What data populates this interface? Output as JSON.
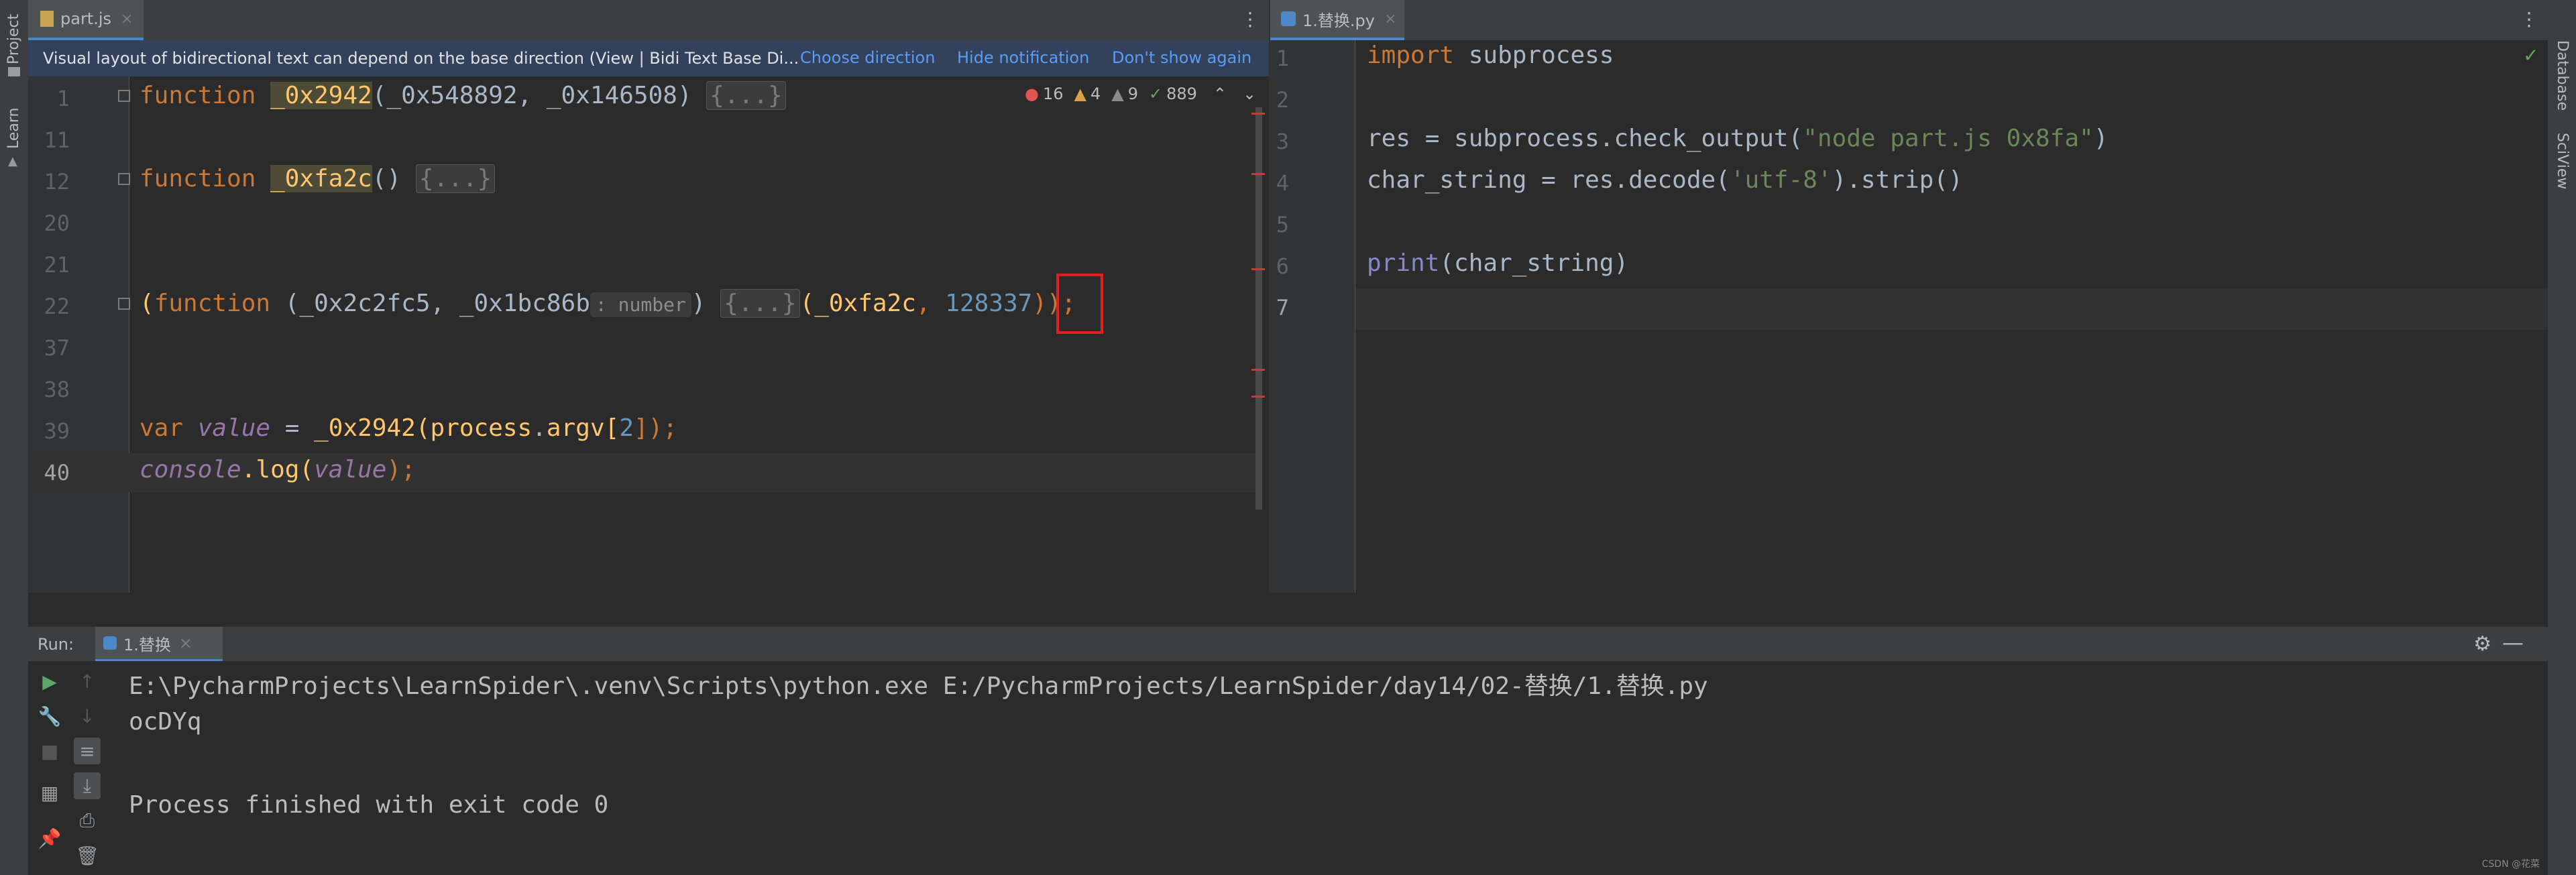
{
  "sidebar": {
    "left_tools": [
      "Project",
      "Learn"
    ],
    "right_tools": [
      "Database",
      "SciView"
    ]
  },
  "left_editor": {
    "tab_label": "part.js",
    "notification": {
      "message": "Visual layout of bidirectional text can depend on the base direction (View | Bidi Text Base Di...",
      "choose": "Choose direction",
      "hide": "Hide notification",
      "dont_show": "Don't show again"
    },
    "inspections": {
      "errors": "16",
      "warnings": "4",
      "weak": "9",
      "ok": "889"
    },
    "line_numbers": [
      "1",
      "11",
      "12",
      "20",
      "21",
      "22",
      "37",
      "38",
      "39",
      "40"
    ],
    "lines": {
      "l1": {
        "kw": "function",
        "name": "_0x2942",
        "params": "(_0x548892, _0x146508) ",
        "fold": "{...}"
      },
      "l12": {
        "kw": "function",
        "name": "_0xfa2c",
        "params": "() ",
        "fold": "{...}"
      },
      "l22": {
        "open": "(",
        "kw": "function",
        "params": " (_0x2c2fc5, _0x1bc86b",
        "hint": ": number",
        "close": ") ",
        "fold": "{...}",
        "args_a": "(",
        "arg1": "_0xfa2c",
        "sep": ", ",
        "arg2": "128337",
        "end": "));"
      },
      "l39": {
        "kw": "var",
        "var": "value",
        "eq": " = ",
        "call": "_0x2942(",
        "obj": "process",
        "dot": ".",
        "prop": "argv",
        "idx_o": "[",
        "idx": "2",
        "idx_c": "]);"
      },
      "l40": {
        "obj": "console",
        "method": ".log(",
        "var": "value",
        "end": ");"
      }
    }
  },
  "right_editor": {
    "tab_label": "1.替换.py",
    "line_numbers": [
      "1",
      "2",
      "3",
      "4",
      "5",
      "6",
      "7"
    ],
    "lines": {
      "l1": {
        "kw": "import",
        "rest": " subprocess"
      },
      "l3": {
        "pre": "res = subprocess.check_output(",
        "str": "\"node part.js 0x8fa\"",
        "post": ")"
      },
      "l4": {
        "pre": "char_string = res.decode(",
        "str": "'utf-8'",
        "post": ").strip()"
      },
      "l6": {
        "kw": "print",
        "rest": "(char_string)"
      }
    }
  },
  "run_panel": {
    "label": "Run:",
    "tab_label": "1.替换",
    "output": [
      "E:\\PycharmProjects\\LearnSpider\\.venv\\Scripts\\python.exe E:/PycharmProjects/LearnSpider/day14/02-替换/1.替换.py",
      "ocDYq",
      "",
      "Process finished with exit code 0"
    ],
    "watermark": "CSDN @花菜"
  },
  "colors": {
    "accent": "#4a88c7",
    "highlight_box": "#e02020"
  }
}
